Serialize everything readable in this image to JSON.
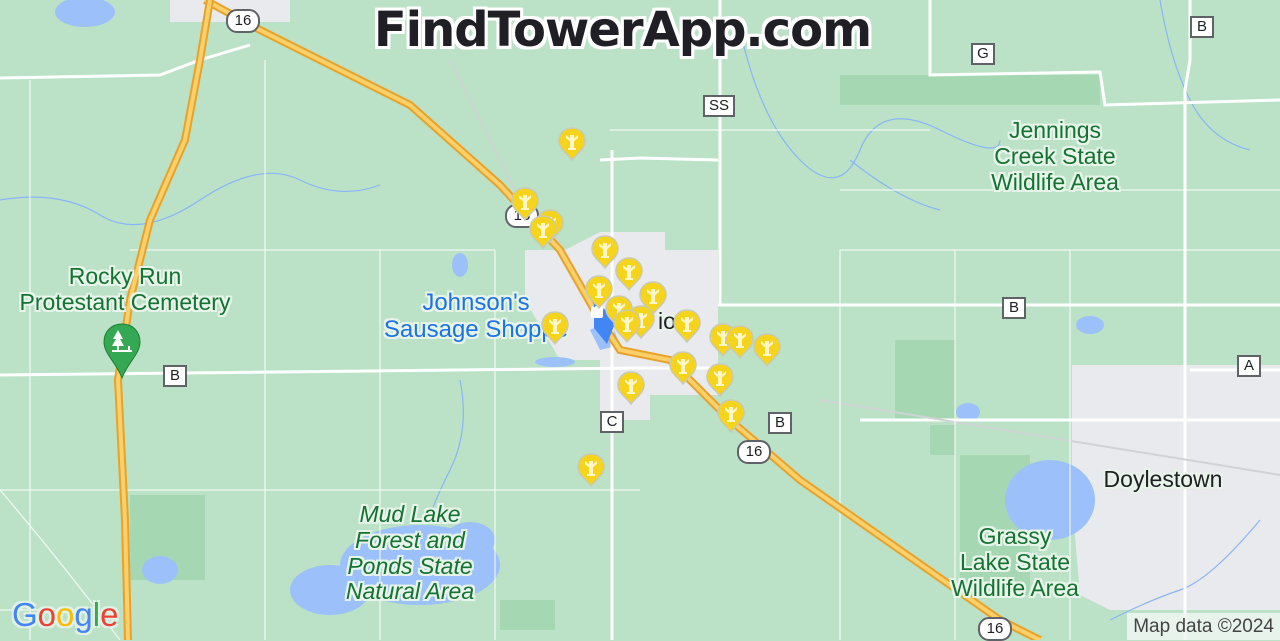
{
  "header": {
    "title": "FindTowerApp.com"
  },
  "colors": {
    "land": "#bbe2c6",
    "park_land": "#a8d9b5",
    "urban": "#e8eaed",
    "water": "#9cc0f9",
    "highway": "#f9ba2f",
    "highway_edge": "#e8a22a",
    "road": "#ffffff",
    "tower_marker": "#f6d41b",
    "park_label": "#137333",
    "poi_label": "#1a73e8"
  },
  "labels": {
    "rocky_run": "Rocky Run\nProtestant Cemetery",
    "jennings": "Jennings\nCreek State\nWildlife Area",
    "mud_lake": "Mud Lake\nForest and\nPonds State\nNatural Area",
    "grassy_lake": "Grassy\nLake State\nWildlife Area",
    "johnsons": "Johnson's\nSausage Shoppe",
    "doylestown": "Doylestown",
    "town_partial": "io"
  },
  "road_shields": {
    "us16_top": "16",
    "us16_mid": "16",
    "us16_bottom": "16",
    "us16_upper": "16",
    "b_west": "B",
    "b_center": "B",
    "b_south": "B",
    "b_northeast": "B",
    "g": "G",
    "ss": "SS",
    "c": "C",
    "a": "A"
  },
  "markers": {
    "tower_count": 21,
    "tower_icon": "cell-tower-icon",
    "cemetery_icon": "tree-icon",
    "shop_icon": "shopping-bag-icon"
  },
  "footer": {
    "google_logo": "Google",
    "attribution": "Map data ©2024"
  }
}
